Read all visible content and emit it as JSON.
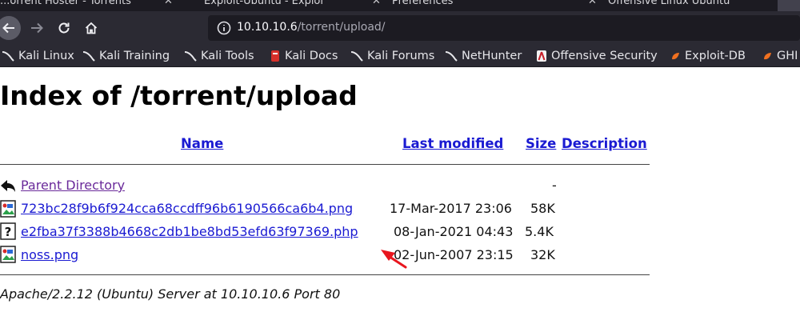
{
  "browser": {
    "tabs": [
      {
        "label": "...orrent Hoster - Torrents"
      },
      {
        "label": "Exploit-Ubuntu - Exploi"
      },
      {
        "label": "Preferences"
      },
      {
        "label": "Offensive Linux Ubuntu"
      }
    ],
    "address_bar": {
      "host": "10.10.10.6",
      "path": "/torrent/upload/"
    },
    "bookmarks": [
      {
        "label": "Kali Linux",
        "icon": "kali-dragon-icon"
      },
      {
        "label": "Kali Training",
        "icon": "kali-dragon-icon"
      },
      {
        "label": "Kali Tools",
        "icon": "kali-dragon-icon"
      },
      {
        "label": "Kali Docs",
        "icon": "kali-docs-icon"
      },
      {
        "label": "Kali Forums",
        "icon": "kali-dragon-icon"
      },
      {
        "label": "NetHunter",
        "icon": "kali-dragon-icon"
      },
      {
        "label": "Offensive Security",
        "icon": "offsec-icon"
      },
      {
        "label": "Exploit-DB",
        "icon": "exploit-db-icon"
      },
      {
        "label": "GHI",
        "icon": "exploit-db-icon"
      }
    ]
  },
  "listing": {
    "title": "Index of /torrent/upload",
    "columns": {
      "name": "Name",
      "last_modified": "Last modified",
      "size": "Size",
      "description": "Description"
    },
    "parent": {
      "name": "Parent Directory",
      "size": "-",
      "icon": "back-arrow-icon"
    },
    "rows": [
      {
        "name": "723bc28f9b6f924cca68ccdff96b6190566ca6b4.png",
        "modified": "17-Mar-2017 23:06",
        "size": "58K",
        "icon": "image-file-icon"
      },
      {
        "name": "e2fba37f3388b4668c2db1be8bd53efd63f97369.php",
        "modified": "08-Jan-2021 04:43",
        "size": "5.4K",
        "icon": "unknown-file-icon"
      },
      {
        "name": "noss.png",
        "modified": "02-Jun-2007 23:15",
        "size": "32K",
        "icon": "image-file-icon"
      }
    ],
    "server_signature": "Apache/2.2.12 (Ubuntu) Server at 10.10.10.6 Port 80"
  },
  "colors": {
    "link": "#1a1ad2",
    "visited_link": "#6a2a9a",
    "chrome_dark": "#2b2a33",
    "annotation_arrow": "#e8161e"
  }
}
